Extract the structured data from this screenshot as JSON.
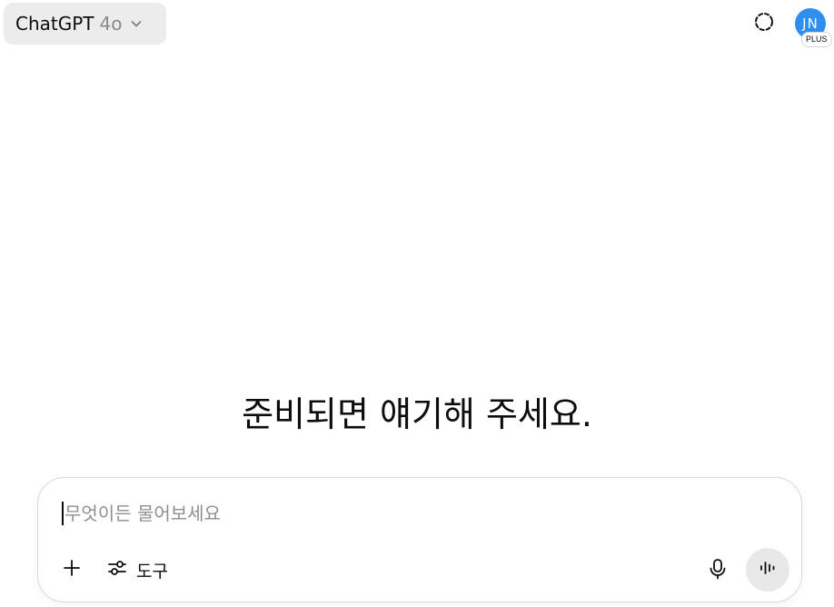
{
  "header": {
    "model_name": "ChatGPT",
    "model_version": "4o",
    "avatar_initials": "JN",
    "plan_badge": "PLUS"
  },
  "main": {
    "heading": "준비되면 얘기해 주세요."
  },
  "composer": {
    "placeholder": "무엇이든 물어보세요",
    "value": "",
    "tools_label": "도구"
  },
  "colors": {
    "avatar_bg": "#2f8ff0",
    "selector_bg": "#ececec",
    "voice_button_bg": "#e8e8e8"
  },
  "icons": {
    "model_dropdown": "chevron-down-icon",
    "temporary_chat": "dashed-circle-icon",
    "add": "plus-icon",
    "tools": "sliders-icon",
    "microphone": "microphone-icon",
    "voice_mode": "waveform-icon"
  }
}
